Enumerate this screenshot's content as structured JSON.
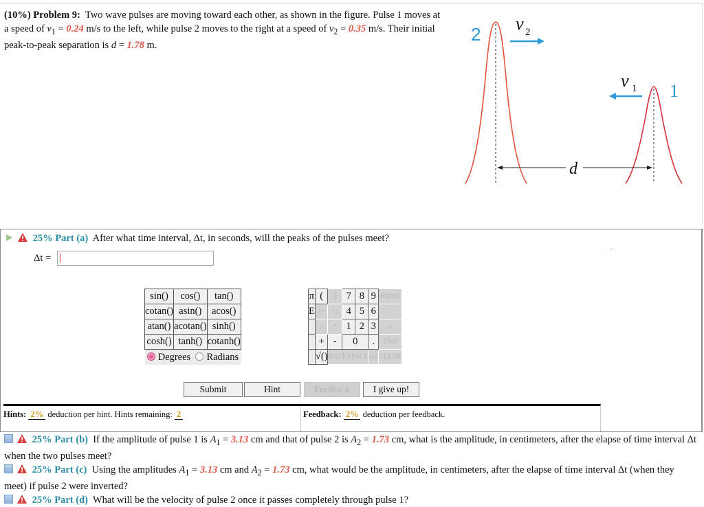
{
  "problem": {
    "weight": "(10%)",
    "title": "Problem 9:",
    "text_1": "Two wave pulses are moving toward each other, as shown in the figure. Pulse 1 moves at a speed of ",
    "v1_symbol": "v",
    "v1_sub": "1",
    "eq": " = ",
    "v1_value": "0.24",
    "text_2": " m/s to the left, while pulse 2 moves to the right at a speed of ",
    "v2_symbol": "v",
    "v2_sub": "2",
    "v2_value": "0.35",
    "text_3": " m/s. Their initial peak-to-peak separation is ",
    "d_symbol": "d",
    "d_value": "1.78",
    "text_4": " m."
  },
  "figure": {
    "pulse2_label": "2",
    "pulse1_label": "1",
    "v2_label": "v",
    "v2_sub": "2",
    "v1_label": "v",
    "v1_sub": "1",
    "d_label": "d",
    "pulse_color": "#e5533c",
    "label_color": "#2f9bd6"
  },
  "part_a": {
    "percent": "25%",
    "label": "Part (a)",
    "question": "After what time interval, Δt, in seconds, will the peaks of the pulses meet?",
    "answer_label": "Δt =",
    "answer_value": ""
  },
  "calculator": {
    "functions": [
      [
        "sin()",
        "cos()",
        "tan()"
      ],
      [
        "cotan()",
        "asin()",
        "acos()"
      ],
      [
        "atan()",
        "acotan()",
        "sinh()"
      ],
      [
        "cosh()",
        "tanh()",
        "cotanh()"
      ]
    ],
    "angle_modes": [
      {
        "label": "Degrees",
        "selected": true
      },
      {
        "label": "Radians",
        "selected": false
      }
    ],
    "keys": {
      "pi": "π",
      "e": "E",
      "lparen": "(",
      "rparen": ")",
      "up": "↑^",
      "down": "^↓",
      "divide": "/",
      "multiply": "*",
      "plus": "+",
      "minus": "-",
      "sqrt": "√()",
      "dot": ".",
      "backspace": "BACKSPACE",
      "del": "DEL",
      "home": "HOME",
      "left": "←",
      "right": "→",
      "end": "END",
      "clear": "CLEAR",
      "d7": "7",
      "d8": "8",
      "d9": "9",
      "d4": "4",
      "d5": "5",
      "d6": "6",
      "d1": "1",
      "d2": "2",
      "d3": "3",
      "d0": "0"
    }
  },
  "buttons": {
    "submit": "Submit",
    "hint": "Hint",
    "feedback": "Feedback",
    "give_up": "I give up!"
  },
  "hints": {
    "label": "Hints:",
    "deduction": "2%",
    "text": "deduction per hint. Hints remaining:",
    "remaining": "2"
  },
  "feedback": {
    "label": "Feedback:",
    "deduction": "2%",
    "text": "deduction per feedback."
  },
  "parts": [
    {
      "percent": "25%",
      "label": "Part (b)",
      "text_1": "If the amplitude of pulse 1 is ",
      "a1": "A",
      "a1_sub": "1",
      "eq": " = ",
      "a1_value": "3.13",
      "text_2": " cm and that of pulse 2 is ",
      "a2": "A",
      "a2_sub": "2",
      "a2_value": "1.73",
      "text_3": " cm, what is the amplitude, in centimeters, after the elapse of time interval Δt when the two pulses meet?"
    },
    {
      "percent": "25%",
      "label": "Part (c)",
      "text_1": "Using the amplitudes ",
      "a1": "A",
      "a1_sub": "1",
      "eq": " = ",
      "a1_value": "3.13",
      "text_2": " cm and ",
      "a2": "A",
      "a2_sub": "2",
      "a2_value": "1.73",
      "text_3": " cm, what would be the amplitude, in centimeters, after the elapse of time interval Δt (when they meet) if pulse 2 were inverted?"
    },
    {
      "percent": "25%",
      "label": "Part (d)",
      "text_1": "What will be the velocity of pulse 2 once it passes completely through pulse 1?"
    }
  ]
}
